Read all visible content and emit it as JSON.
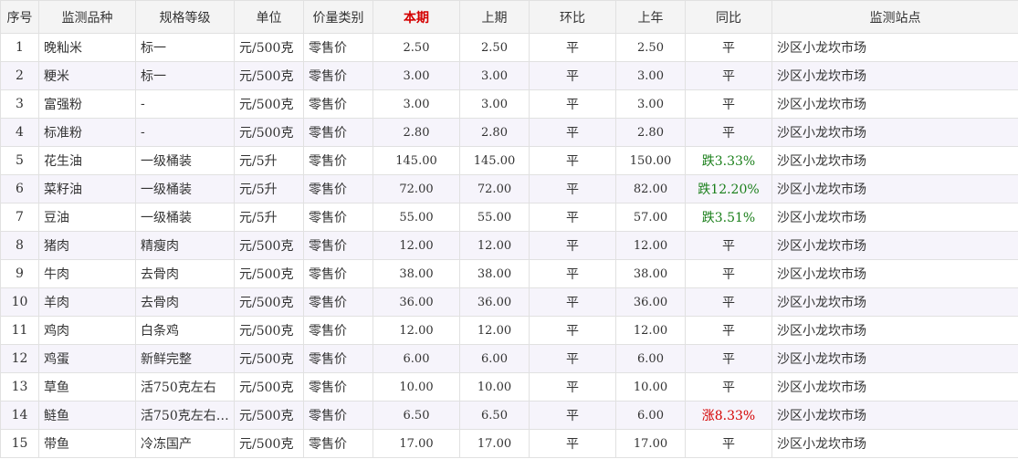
{
  "table": {
    "headers": [
      "序号",
      "监测品种",
      "规格等级",
      "单位",
      "价量类别",
      "本期",
      "上期",
      "环比",
      "上年",
      "同比",
      "监测站点"
    ],
    "rows": [
      {
        "no": "1",
        "name": "晚籼米",
        "grade": "标一",
        "unit": "元/500克",
        "type": "零售价",
        "current": "2.50",
        "previous": "2.50",
        "mom": "平",
        "last_year": "2.50",
        "yoy": "平",
        "yoy_trend": "flat",
        "station": "沙区小龙坎市场"
      },
      {
        "no": "2",
        "name": "粳米",
        "grade": "标一",
        "unit": "元/500克",
        "type": "零售价",
        "current": "3.00",
        "previous": "3.00",
        "mom": "平",
        "last_year": "3.00",
        "yoy": "平",
        "yoy_trend": "flat",
        "station": "沙区小龙坎市场"
      },
      {
        "no": "3",
        "name": "富强粉",
        "grade": "-",
        "unit": "元/500克",
        "type": "零售价",
        "current": "3.00",
        "previous": "3.00",
        "mom": "平",
        "last_year": "3.00",
        "yoy": "平",
        "yoy_trend": "flat",
        "station": "沙区小龙坎市场"
      },
      {
        "no": "4",
        "name": "标准粉",
        "grade": "-",
        "unit": "元/500克",
        "type": "零售价",
        "current": "2.80",
        "previous": "2.80",
        "mom": "平",
        "last_year": "2.80",
        "yoy": "平",
        "yoy_trend": "flat",
        "station": "沙区小龙坎市场"
      },
      {
        "no": "5",
        "name": "花生油",
        "grade": "一级桶装",
        "unit": "元/5升",
        "type": "零售价",
        "current": "145.00",
        "previous": "145.00",
        "mom": "平",
        "last_year": "150.00",
        "yoy": "跌3.33%",
        "yoy_trend": "down",
        "station": "沙区小龙坎市场"
      },
      {
        "no": "6",
        "name": "菜籽油",
        "grade": "一级桶装",
        "unit": "元/5升",
        "type": "零售价",
        "current": "72.00",
        "previous": "72.00",
        "mom": "平",
        "last_year": "82.00",
        "yoy": "跌12.20%",
        "yoy_trend": "down",
        "station": "沙区小龙坎市场"
      },
      {
        "no": "7",
        "name": "豆油",
        "grade": "一级桶装",
        "unit": "元/5升",
        "type": "零售价",
        "current": "55.00",
        "previous": "55.00",
        "mom": "平",
        "last_year": "57.00",
        "yoy": "跌3.51%",
        "yoy_trend": "down",
        "station": "沙区小龙坎市场"
      },
      {
        "no": "8",
        "name": "猪肉",
        "grade": "精瘦肉",
        "unit": "元/500克",
        "type": "零售价",
        "current": "12.00",
        "previous": "12.00",
        "mom": "平",
        "last_year": "12.00",
        "yoy": "平",
        "yoy_trend": "flat",
        "station": "沙区小龙坎市场"
      },
      {
        "no": "9",
        "name": "牛肉",
        "grade": "去骨肉",
        "unit": "元/500克",
        "type": "零售价",
        "current": "38.00",
        "previous": "38.00",
        "mom": "平",
        "last_year": "38.00",
        "yoy": "平",
        "yoy_trend": "flat",
        "station": "沙区小龙坎市场"
      },
      {
        "no": "10",
        "name": "羊肉",
        "grade": "去骨肉",
        "unit": "元/500克",
        "type": "零售价",
        "current": "36.00",
        "previous": "36.00",
        "mom": "平",
        "last_year": "36.00",
        "yoy": "平",
        "yoy_trend": "flat",
        "station": "沙区小龙坎市场"
      },
      {
        "no": "11",
        "name": "鸡肉",
        "grade": "白条鸡",
        "unit": "元/500克",
        "type": "零售价",
        "current": "12.00",
        "previous": "12.00",
        "mom": "平",
        "last_year": "12.00",
        "yoy": "平",
        "yoy_trend": "flat",
        "station": "沙区小龙坎市场"
      },
      {
        "no": "12",
        "name": "鸡蛋",
        "grade": "新鲜完整",
        "unit": "元/500克",
        "type": "零售价",
        "current": "6.00",
        "previous": "6.00",
        "mom": "平",
        "last_year": "6.00",
        "yoy": "平",
        "yoy_trend": "flat",
        "station": "沙区小龙坎市场"
      },
      {
        "no": "13",
        "name": "草鱼",
        "grade": "活750克左右",
        "unit": "元/500克",
        "type": "零售价",
        "current": "10.00",
        "previous": "10.00",
        "mom": "平",
        "last_year": "10.00",
        "yoy": "平",
        "yoy_trend": "flat",
        "station": "沙区小龙坎市场"
      },
      {
        "no": "14",
        "name": "鲢鱼",
        "grade": "活750克左右…",
        "unit": "元/500克",
        "type": "零售价",
        "current": "6.50",
        "previous": "6.50",
        "mom": "平",
        "last_year": "6.00",
        "yoy": "涨8.33%",
        "yoy_trend": "up",
        "station": "沙区小龙坎市场"
      },
      {
        "no": "15",
        "name": "带鱼",
        "grade": "冷冻国产",
        "unit": "元/500克",
        "type": "零售价",
        "current": "17.00",
        "previous": "17.00",
        "mom": "平",
        "last_year": "17.00",
        "yoy": "平",
        "yoy_trend": "flat",
        "station": "沙区小龙坎市场"
      }
    ]
  },
  "colors": {
    "header_bg": "#f4f4f4",
    "even_row_bg": "#f6f4fb",
    "border": "#e1e1e1",
    "current_header": "#d40000",
    "down": "#1a7f1a",
    "up": "#d40000"
  }
}
